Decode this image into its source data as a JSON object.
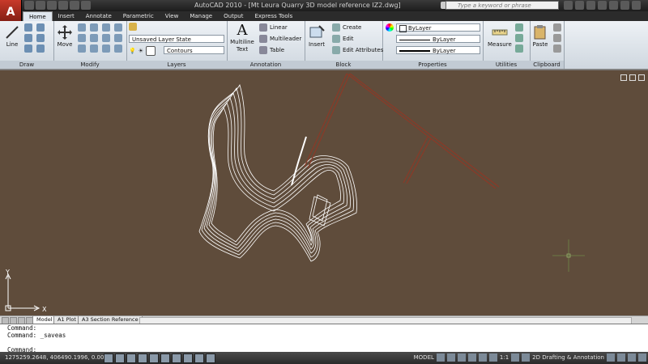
{
  "app": {
    "title": "AutoCAD 2010 - [Mt Leura Quarry 3D model reference IZ2.dwg]",
    "search_placeholder": "Type a keyword or phrase"
  },
  "tabs": [
    "Home",
    "Insert",
    "Annotate",
    "Parametric",
    "View",
    "Manage",
    "Output",
    "Express Tools"
  ],
  "ribbon": {
    "draw": {
      "title": "Draw",
      "line": "Line"
    },
    "modify": {
      "title": "Modify",
      "move": "Move"
    },
    "layers": {
      "title": "Layers",
      "layer_state": "Unsaved Layer State",
      "current_layer": "Contours"
    },
    "annotation": {
      "title": "Annotation",
      "text": "Multiline Text",
      "linear": "Linear",
      "multileader": "Multileader",
      "table": "Table"
    },
    "block": {
      "title": "Block",
      "insert": "Insert",
      "create": "Create",
      "edit": "Edit",
      "edit_attributes": "Edit Attributes"
    },
    "properties": {
      "title": "Properties",
      "color": "ByLayer",
      "linetype": "ByLayer",
      "lineweight": "ByLayer"
    },
    "utilities": {
      "title": "Utilities",
      "measure": "Measure"
    },
    "clipboard": {
      "title": "Clipboard",
      "paste": "Paste"
    }
  },
  "canvas": {
    "ucs_x": "X",
    "ucs_y": "Y"
  },
  "layout_tabs": [
    "Model",
    "A1 Plot",
    "A3 Section Reference"
  ],
  "command_lines": [
    "Command:",
    "Command:  _saveas",
    "",
    "Command:"
  ],
  "status": {
    "coordinates": "1275259.2648, 406490.1996, 0.0000",
    "model": "MODEL",
    "scale": "1:1",
    "workspace": "2D Drafting & Annotation"
  }
}
